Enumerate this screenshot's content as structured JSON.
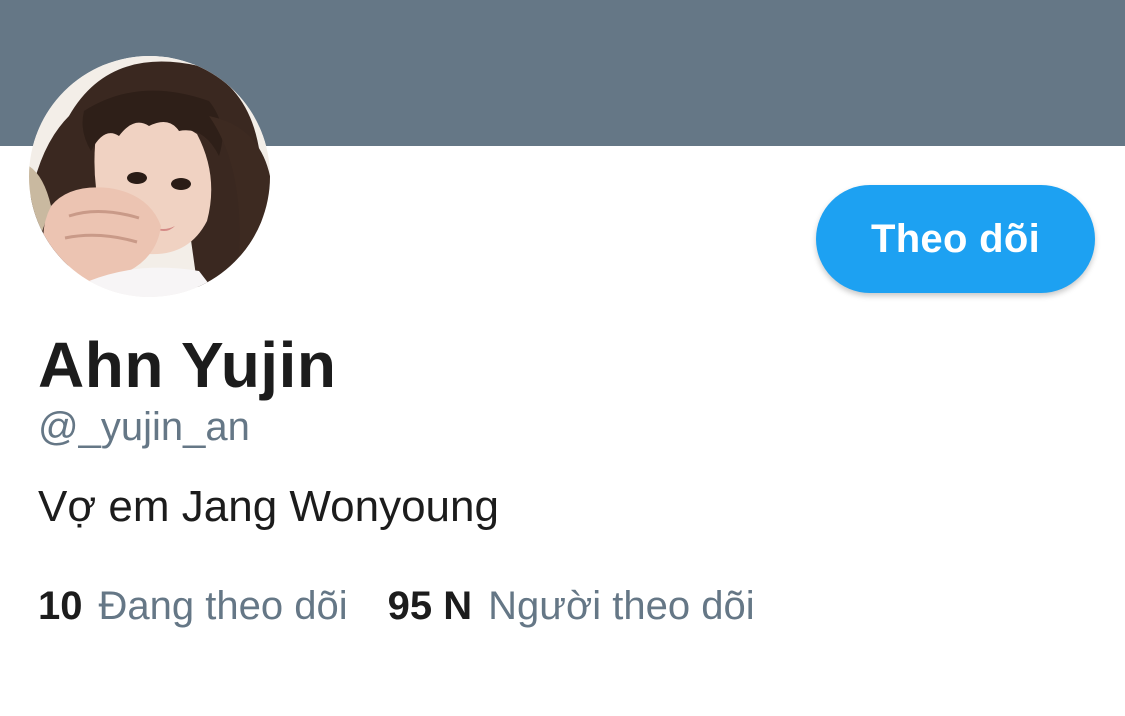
{
  "colors": {
    "banner": "#657786",
    "accent": "#1da1f2",
    "text_primary": "#1c1c1c",
    "text_secondary": "#657786"
  },
  "profile": {
    "display_name": "Ahn Yujin",
    "handle": "@_yujin_an",
    "bio": "Vợ em Jang Wonyoung",
    "avatar_icon": "profile-photo"
  },
  "actions": {
    "follow_label": "Theo dõi"
  },
  "stats": [
    {
      "count": "10",
      "label": "Đang theo dõi"
    },
    {
      "count": "95 N",
      "label": "Người theo dõi"
    }
  ]
}
